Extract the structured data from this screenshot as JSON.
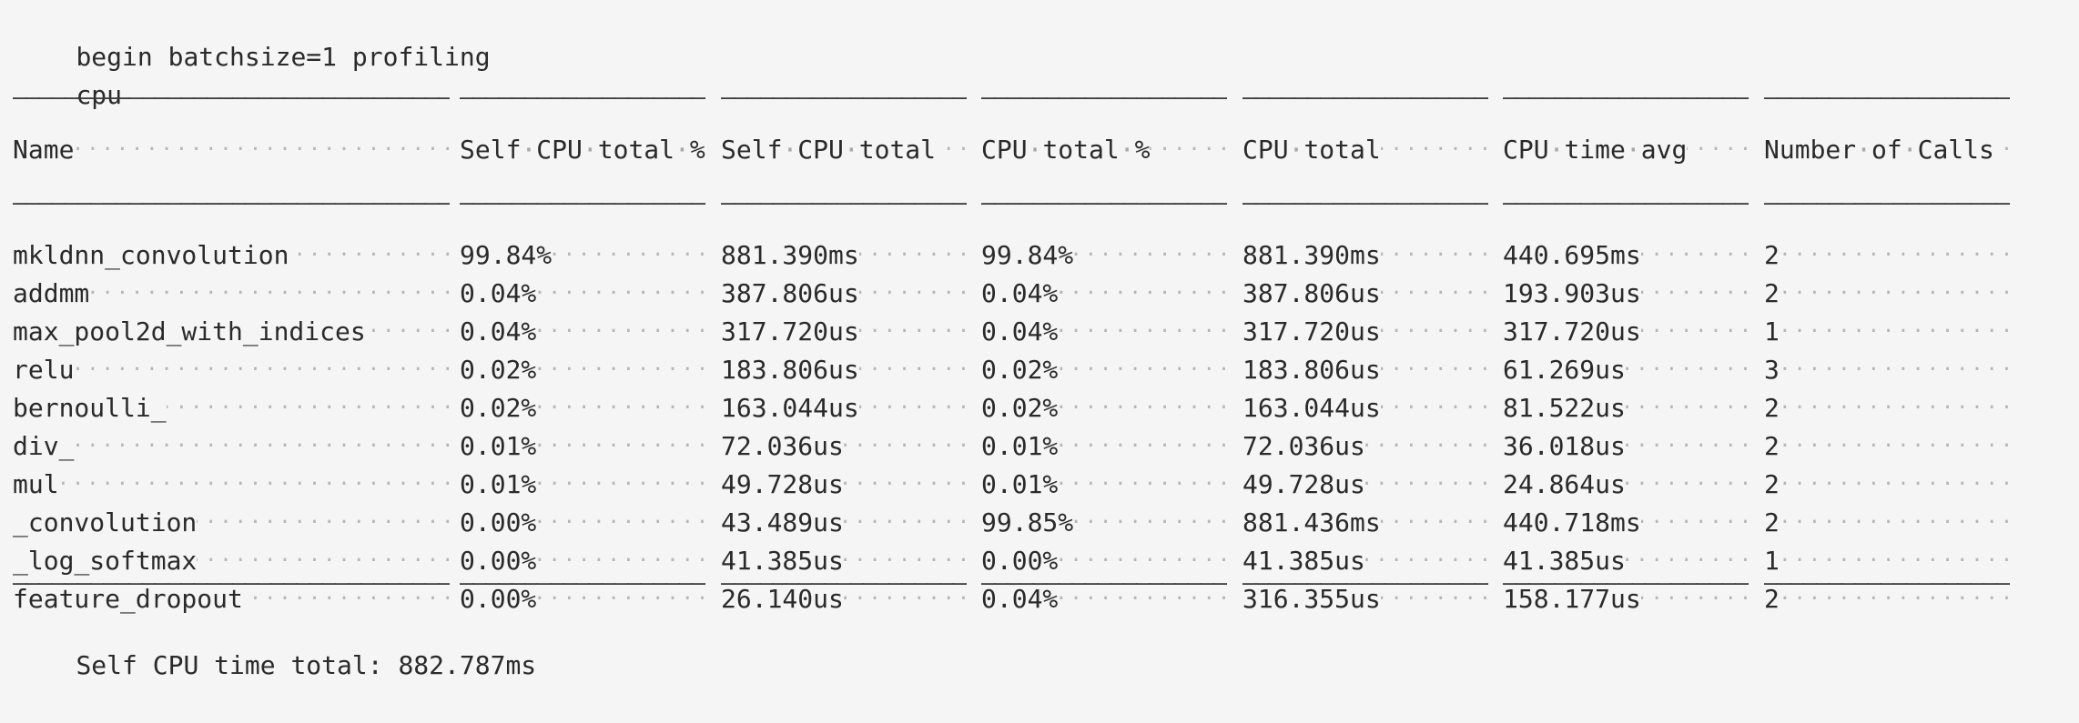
{
  "header_lines": [
    "begin batchsize=1 profiling",
    "cpu"
  ],
  "columns": [
    "Name",
    "Self CPU total %",
    "Self CPU total",
    "CPU total %",
    "CPU total",
    "CPU time avg",
    "Number of Calls"
  ],
  "rows": [
    [
      "mkldnn_convolution",
      "99.84%",
      "881.390ms",
      "99.84%",
      "881.390ms",
      "440.695ms",
      "2"
    ],
    [
      "addmm",
      "0.04%",
      "387.806us",
      "0.04%",
      "387.806us",
      "193.903us",
      "2"
    ],
    [
      "max_pool2d_with_indices",
      "0.04%",
      "317.720us",
      "0.04%",
      "317.720us",
      "317.720us",
      "1"
    ],
    [
      "relu",
      "0.02%",
      "183.806us",
      "0.02%",
      "183.806us",
      "61.269us",
      "3"
    ],
    [
      "bernoulli_",
      "0.02%",
      "163.044us",
      "0.02%",
      "163.044us",
      "81.522us",
      "2"
    ],
    [
      "div_",
      "0.01%",
      "72.036us",
      "0.01%",
      "72.036us",
      "36.018us",
      "2"
    ],
    [
      "mul",
      "0.01%",
      "49.728us",
      "0.01%",
      "49.728us",
      "24.864us",
      "2"
    ],
    [
      "_convolution",
      "0.00%",
      "43.489us",
      "99.85%",
      "881.436ms",
      "440.718ms",
      "2"
    ],
    [
      "_log_softmax",
      "0.00%",
      "41.385us",
      "0.00%",
      "41.385us",
      "41.385us",
      "1"
    ],
    [
      "feature_dropout",
      "0.00%",
      "26.140us",
      "0.04%",
      "316.355us",
      "158.177us",
      "2"
    ]
  ],
  "footer_line": "Self CPU time total: 882.787ms"
}
